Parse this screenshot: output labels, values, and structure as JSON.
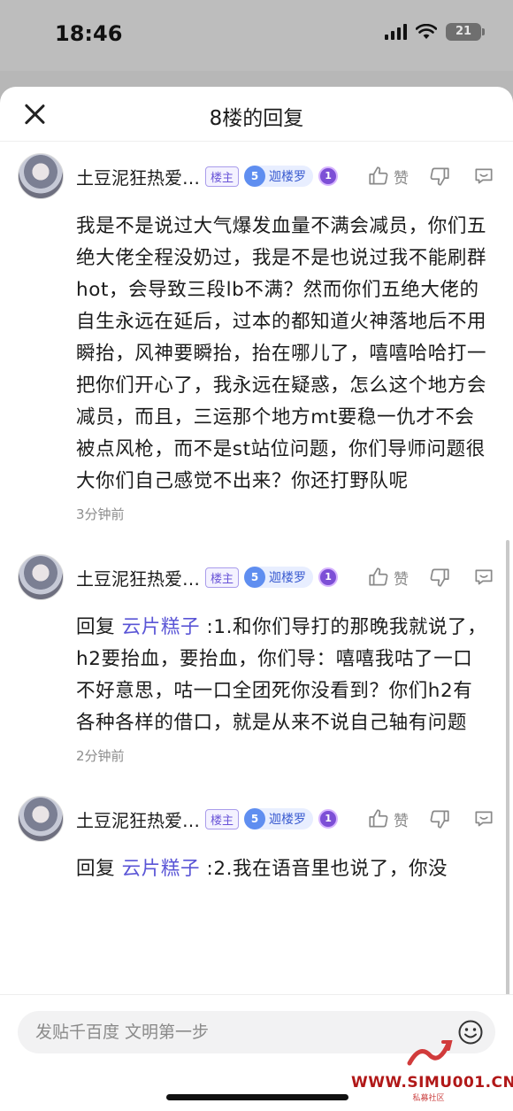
{
  "status_bar": {
    "time": "18:46",
    "battery": "21"
  },
  "header": {
    "title": "8楼的回复"
  },
  "posts": [
    {
      "username": "土豆泥狂热爱…",
      "owner_badge": "楼主",
      "level_num": "5",
      "level_name": "迦楼罗",
      "medal": "1",
      "like_label": "赞",
      "body": "我是不是说过大气爆发血量不满会减员，你们五绝大佬全程没奶过，我是不是也说过我不能刷群hot，会导致三段lb不满？然而你们五绝大佬的自生永远在延后，过本的都知道火神落地后不用瞬抬，风神要瞬抬，抬在哪儿了，嘻嘻哈哈打一把你们开心了，我永远在疑惑，怎么这个地方会减员，而且，三运那个地方mt要稳一仇才不会被点风枪，而不是st站位问题，你们导师问题很大你们自己感觉不出来？你还打野队呢",
      "time": "3分钟前"
    },
    {
      "username": "土豆泥狂热爱…",
      "owner_badge": "楼主",
      "level_num": "5",
      "level_name": "迦楼罗",
      "medal": "1",
      "like_label": "赞",
      "reply_prefix": "回复 ",
      "mention": "云片糕子",
      "body": " :1.和你们导打的那晚我就说了，h2要抬血，要抬血，你们导：嘻嘻我咕了一口不好意思，咕一口全团死你没看到？你们h2有各种各样的借口，就是从来不说自己轴有问题",
      "time": "2分钟前"
    },
    {
      "username": "土豆泥狂热爱…",
      "owner_badge": "楼主",
      "level_num": "5",
      "level_name": "迦楼罗",
      "medal": "1",
      "like_label": "赞",
      "reply_prefix": "回复 ",
      "mention": "云片糕子",
      "body": " :2.我在语音里也说了，你没"
    }
  ],
  "input": {
    "placeholder": "发贴千百度 文明第一步"
  },
  "watermark": {
    "text": "WWW.SIMU001.CN",
    "sub": "私募社区"
  },
  "colors": {
    "mention": "#5a55d6",
    "owner_badge": "#6a55d8",
    "level_badge": "#3a5bd0"
  }
}
